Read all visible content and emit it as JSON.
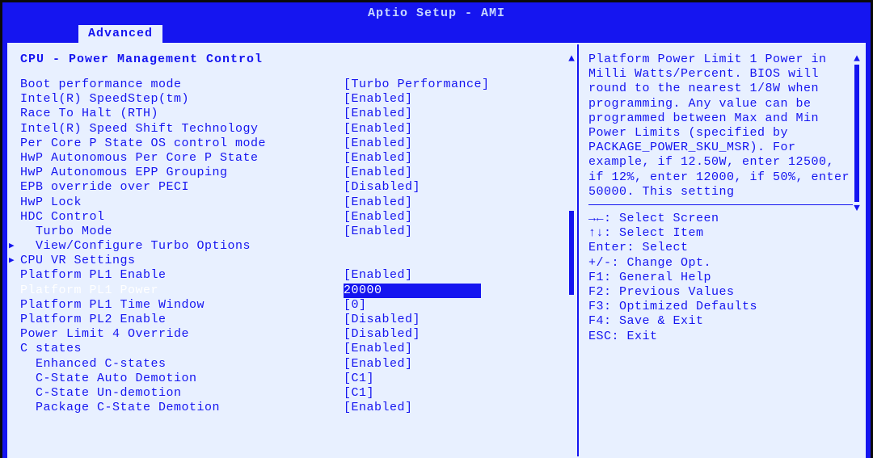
{
  "title": "Aptio Setup - AMI",
  "tab": "Advanced",
  "section_title": "CPU - Power Management Control",
  "rows": [
    {
      "label": "Boot performance mode",
      "value": "[Turbo Performance]",
      "indent": 0,
      "submenu": false
    },
    {
      "label": "Intel(R) SpeedStep(tm)",
      "value": "[Enabled]",
      "indent": 0,
      "submenu": false
    },
    {
      "label": "Race To Halt (RTH)",
      "value": "[Enabled]",
      "indent": 0,
      "submenu": false
    },
    {
      "label": "Intel(R) Speed Shift Technology",
      "value": "[Enabled]",
      "indent": 0,
      "submenu": false
    },
    {
      "label": "Per Core P State OS control mode",
      "value": "[Enabled]",
      "indent": 0,
      "submenu": false
    },
    {
      "label": "HwP Autonomous Per Core P State",
      "value": "[Enabled]",
      "indent": 0,
      "submenu": false
    },
    {
      "label": "HwP Autonomous EPP Grouping",
      "value": "[Enabled]",
      "indent": 0,
      "submenu": false
    },
    {
      "label": "EPB override over PECI",
      "value": "[Disabled]",
      "indent": 0,
      "submenu": false
    },
    {
      "label": "HwP Lock",
      "value": "[Enabled]",
      "indent": 0,
      "submenu": false
    },
    {
      "label": "HDC Control",
      "value": "[Enabled]",
      "indent": 0,
      "submenu": false
    },
    {
      "label": "Turbo Mode",
      "value": "[Enabled]",
      "indent": 1,
      "submenu": false
    },
    {
      "label": "View/Configure Turbo Options",
      "value": "",
      "indent": 1,
      "submenu": true
    },
    {
      "label": "CPU VR Settings",
      "value": "",
      "indent": 0,
      "submenu": true
    },
    {
      "label": "Platform PL1 Enable",
      "value": "[Enabled]",
      "indent": 0,
      "submenu": false
    },
    {
      "label": "Platform PL1 Power",
      "value": "20000",
      "indent": 0,
      "submenu": false,
      "selected": true
    },
    {
      "label": "Platform PL1 Time Window",
      "value": "[0]",
      "indent": 0,
      "submenu": false
    },
    {
      "label": "Platform PL2 Enable",
      "value": "[Disabled]",
      "indent": 0,
      "submenu": false
    },
    {
      "label": "Power Limit 4 Override",
      "value": "[Disabled]",
      "indent": 0,
      "submenu": false
    },
    {
      "label": "C states",
      "value": "[Enabled]",
      "indent": 0,
      "submenu": false
    },
    {
      "label": "Enhanced C-states",
      "value": "[Enabled]",
      "indent": 1,
      "submenu": false
    },
    {
      "label": "C-State Auto Demotion",
      "value": "[C1]",
      "indent": 1,
      "submenu": false
    },
    {
      "label": "C-State Un-demotion",
      "value": "[C1]",
      "indent": 1,
      "submenu": false
    },
    {
      "label": "Package C-State Demotion",
      "value": "[Enabled]",
      "indent": 1,
      "submenu": false
    }
  ],
  "help_text": "Platform Power Limit 1 Power in Milli Watts/Percent. BIOS will round to the nearest 1/8W when programming. Any value can be programmed between Max and Min Power Limits (specified by PACKAGE_POWER_SKU_MSR). For example, if 12.50W, enter 12500, if 12%, enter 12000, if 50%, enter 50000. This setting",
  "legend": [
    "→←: Select Screen",
    "↑↓: Select Item",
    "Enter: Select",
    "+/-: Change Opt.",
    "F1: General Help",
    "F2: Previous Values",
    "F3: Optimized Defaults",
    "F4: Save & Exit",
    "ESC: Exit"
  ]
}
